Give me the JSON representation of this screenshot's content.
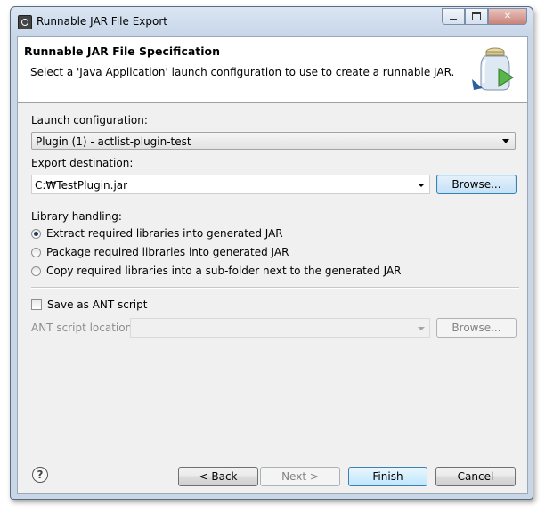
{
  "window": {
    "title": "Runnable JAR File Export",
    "controls": {
      "minimize": "minimize-icon",
      "maximize": "maximize-icon",
      "close": "close-icon"
    }
  },
  "header": {
    "title": "Runnable JAR File Specification",
    "description": "Select a 'Java Application' launch configuration to use to create a runnable JAR.",
    "icon": "jar-export-icon"
  },
  "launch": {
    "label": "Launch configuration:",
    "value": "Plugin (1) - actlist-plugin-test"
  },
  "export": {
    "label": "Export destination:",
    "value": "C:₩TestPlugin.jar",
    "browse": "Browse..."
  },
  "library": {
    "label": "Library handling:",
    "options": [
      {
        "label": "Extract required libraries into generated JAR",
        "checked": true
      },
      {
        "label": "Package required libraries into generated JAR",
        "checked": false
      },
      {
        "label": "Copy required libraries into a sub-folder next to the generated JAR",
        "checked": false
      }
    ]
  },
  "ant": {
    "checkbox_label": "Save as ANT script",
    "checked": false,
    "location_label": "ANT script location:",
    "location_value": "",
    "browse": "Browse..."
  },
  "footer": {
    "help_icon": "help-icon",
    "help_glyph": "?",
    "back": "< Back",
    "next": "Next >",
    "finish": "Finish",
    "cancel": "Cancel"
  },
  "colors": {
    "accent": "#3c7fb1",
    "frame": "#c9d6e6",
    "dialog_bg": "#f0f0f0"
  }
}
